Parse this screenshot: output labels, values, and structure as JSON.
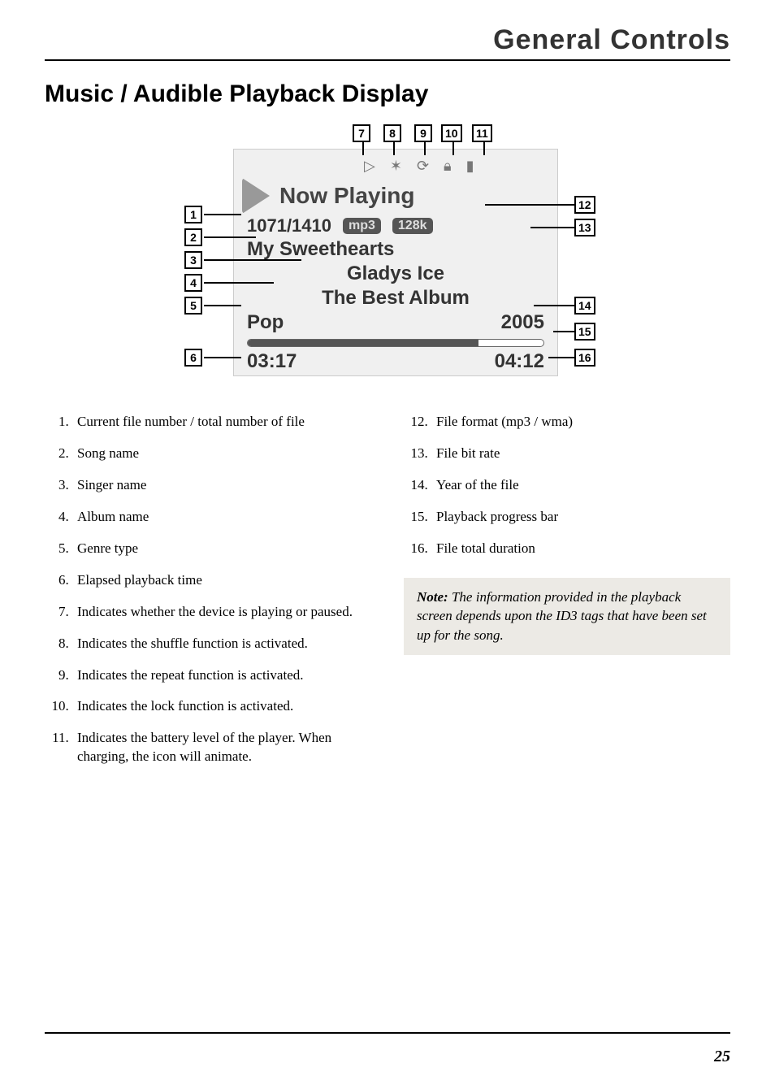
{
  "header": {
    "title": "General Controls"
  },
  "section": {
    "title": "Music / Audible Playback Display"
  },
  "screen": {
    "now_playing": "Now Playing",
    "file_counter": "1071/1410",
    "format_pill": "mp3",
    "bitrate_pill": "128k",
    "song_name": "My Sweethearts",
    "singer": "Gladys Ice",
    "album": "The Best Album",
    "genre": "Pop",
    "year": "2005",
    "elapsed": "03:17",
    "duration": "04:12"
  },
  "callouts": {
    "c1": "1",
    "c2": "2",
    "c3": "3",
    "c4": "4",
    "c5": "5",
    "c6": "6",
    "c7": "7",
    "c8": "8",
    "c9": "9",
    "c10": "10",
    "c11": "11",
    "c12": "12",
    "c13": "13",
    "c14": "14",
    "c15": "15",
    "c16": "16"
  },
  "legend_left": [
    "Current file number / total number of file",
    "Song name",
    "Singer name",
    "Album name",
    "Genre type",
    "Elapsed playback time",
    "Indicates whether the device is playing or paused.",
    "Indicates the shuffle function is activated.",
    "Indicates the repeat function is activated.",
    "Indicates the lock function is activated.",
    "Indicates the battery level of the player. When charging, the icon will animate."
  ],
  "legend_right": [
    "File format (mp3 / wma)",
    "File bit rate",
    "Year of the file",
    "Playback progress bar",
    "File total duration"
  ],
  "note": {
    "label": "Note:",
    "text": " The information provided in the playback screen depends upon the ID3 tags that have been set up for the song."
  },
  "footer": {
    "page": "25"
  }
}
